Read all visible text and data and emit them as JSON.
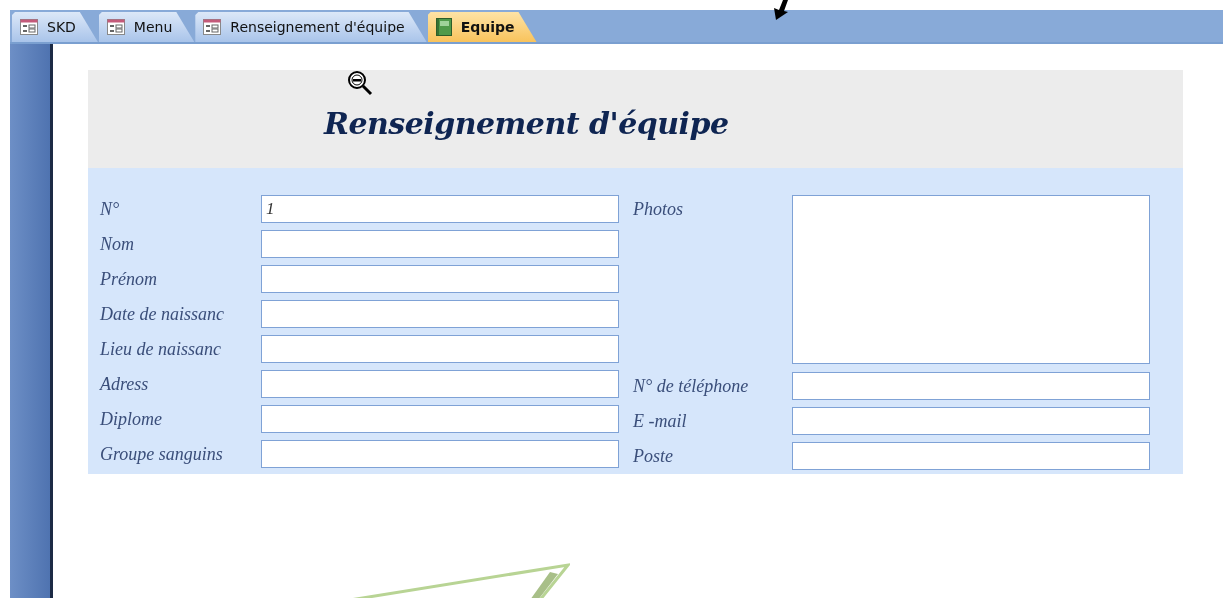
{
  "tabs": [
    {
      "label": "SKD",
      "kind": "form",
      "selected": false
    },
    {
      "label": "Menu",
      "kind": "form",
      "selected": false
    },
    {
      "label": "Renseignement d'équipe",
      "kind": "form",
      "selected": false
    },
    {
      "label": "Equipe",
      "kind": "table",
      "selected": true
    }
  ],
  "form": {
    "title": "Renseignement d'équipe",
    "left_fields": [
      {
        "label": "N°",
        "value": "1"
      },
      {
        "label": "Nom"
      },
      {
        "label": "Prénom"
      },
      {
        "label": "Date de naissanc"
      },
      {
        "label": "Lieu de naissanc"
      },
      {
        "label": "Adress"
      },
      {
        "label": "Diplome"
      },
      {
        "label": "Groupe sanguins"
      }
    ],
    "right_fields": [
      {
        "label": "Photos",
        "kind": "image"
      },
      {
        "label": "N° de téléphone",
        "kind": "text"
      },
      {
        "label": "E -mail",
        "kind": "text"
      },
      {
        "label": "Poste",
        "kind": "text"
      }
    ]
  }
}
